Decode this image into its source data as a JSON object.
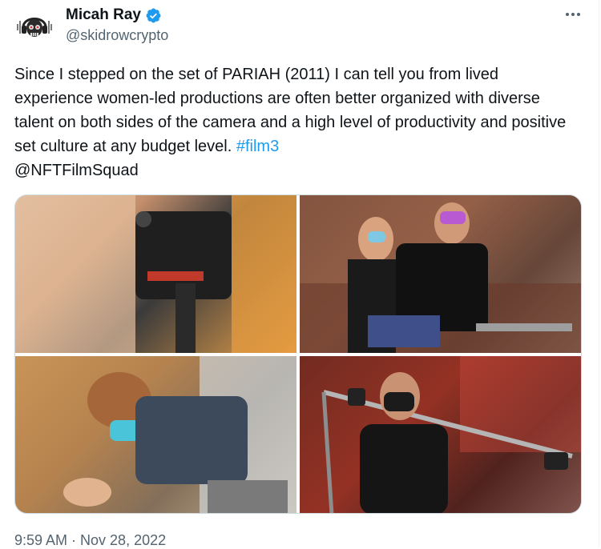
{
  "author": {
    "display_name": "Micah Ray",
    "handle": "@skidrowcrypto",
    "verified": true,
    "avatar_icon": "skull-headphones-avatar"
  },
  "tweet": {
    "text_main": "Since I stepped on the set of PARIAH (2011) I can tell you from lived experience women-led productions are often better organized with diverse talent on both sides of the camera and a high level of productivity and positive set culture at any budget level. ",
    "hashtag": "#film3",
    "mention": "@NFTFilmSquad",
    "timestamp": "9:59 AM · Nov 28, 2022"
  },
  "media": {
    "photos": [
      {
        "name": "photo-camera-operator"
      },
      {
        "name": "photo-director-gesturing"
      },
      {
        "name": "photo-crew-member-kneeling"
      },
      {
        "name": "photo-woman-boom-pole"
      }
    ]
  },
  "colors": {
    "text": "#0f1419",
    "secondary": "#536471",
    "link": "#1d9bf0",
    "verified": "#1d9bf0"
  }
}
